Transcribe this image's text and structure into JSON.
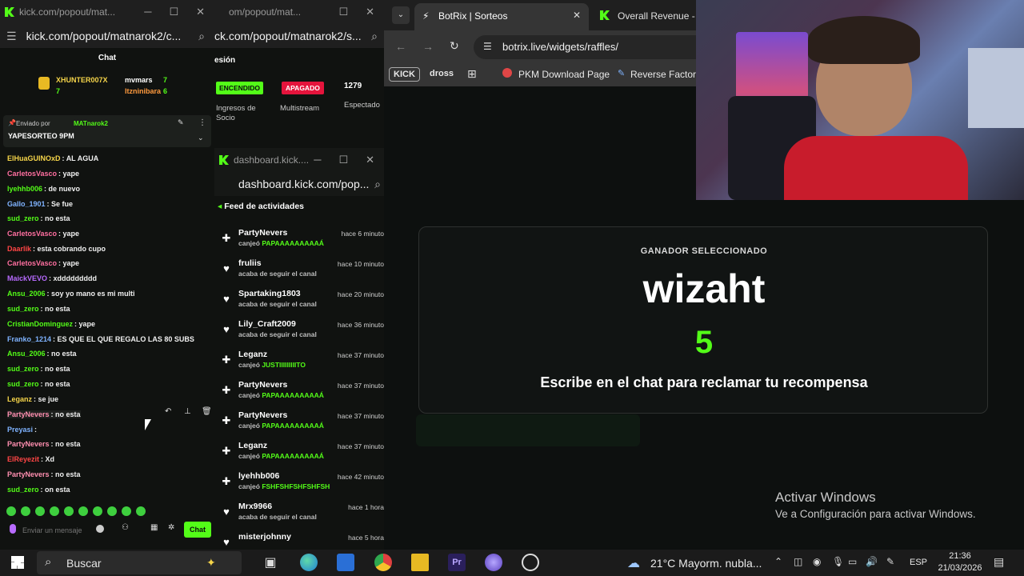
{
  "chat_window": {
    "title": "kick.com/popout/mat...",
    "url": "kick.com/popout/matnarok2/c...",
    "header": "Chat",
    "top_gifters": [
      {
        "name": "XHUNTER007X",
        "count": "7"
      },
      {
        "name": "mvmars",
        "count": "7"
      },
      {
        "name": "ltzninibara",
        "count": "6"
      }
    ],
    "pinned": {
      "sent_by_label": "Enviado por",
      "sent_by": "MATnarok2",
      "message": "YAPESORTEO 9PM"
    },
    "messages": [
      {
        "user": "ElHuaGUINOxD",
        "text": "AL AGUA",
        "color": "#f6d54a"
      },
      {
        "user": "CarletosVasco",
        "text": "yape",
        "color": "#ff6fa0"
      },
      {
        "user": "lyehhb006",
        "text": "de nuevo",
        "color": "#53fc18"
      },
      {
        "user": "Gallo_1901",
        "text": "Se fue",
        "color": "#7fb3ff"
      },
      {
        "user": "sud_zero",
        "text": "no esta",
        "color": "#53fc18"
      },
      {
        "user": "CarletosVasco",
        "text": "yape",
        "color": "#ff6fa0"
      },
      {
        "user": "Daarlik",
        "text": "esta cobrando cupo",
        "color": "#ff4545"
      },
      {
        "user": "CarletosVasco",
        "text": "yape",
        "color": "#ff6fa0"
      },
      {
        "user": "MaickVEVO",
        "text": "xddddddddd",
        "color": "#b86bff"
      },
      {
        "user": "Ansu_2006",
        "text": "soy yo mano es mi multi",
        "color": "#53fc18"
      },
      {
        "user": "sud_zero",
        "text": "no esta",
        "color": "#53fc18"
      },
      {
        "user": "CristianDominguez",
        "text": "yape",
        "color": "#53fc18"
      },
      {
        "user": "Franko_1214",
        "text": "ES QUE EL QUE REGALO LAS 80 SUBS",
        "color": "#7fb3ff"
      },
      {
        "user": "Ansu_2006",
        "text": "no esta",
        "color": "#53fc18"
      },
      {
        "user": "sud_zero",
        "text": "no esta",
        "color": "#53fc18"
      },
      {
        "user": "sud_zero",
        "text": "no esta",
        "color": "#53fc18"
      },
      {
        "user": "Leganz",
        "text": "se jue",
        "color": "#f6d54a"
      },
      {
        "user": "PartyNevers",
        "text": "no esta",
        "color": "#ff8fb0"
      },
      {
        "user": "Preyasi",
        "text": "",
        "color": "#7fb3ff"
      },
      {
        "user": "PartyNevers",
        "text": "no esta",
        "color": "#ff8fb0"
      },
      {
        "user": "ElReyezit",
        "text": "Xd",
        "color": "#ff4545"
      },
      {
        "user": "PartyNevers",
        "text": "no esta",
        "color": "#ff8fb0"
      },
      {
        "user": "sud_zero",
        "text": "on esta",
        "color": "#53fc18"
      }
    ],
    "input_placeholder": "Enviar un mensaje",
    "send_button": "Chat"
  },
  "dashboard_window": {
    "title": "om/popout/mat...",
    "url": "ck.com/popout/matnarok2/s...",
    "section": "esión",
    "toggle_on": "ENCENDIDO",
    "toggle_off": "APAGADO",
    "viewer_count": "1279",
    "col1": "Ingresos de Socio",
    "col2": "Multistream",
    "col3": "Espectado"
  },
  "feed_window": {
    "title": "dashboard.kick....",
    "url": "dashboard.kick.com/pop...",
    "feed_title": "Feed de actividades",
    "items": [
      {
        "icon": "redeem",
        "name": "PartyNevers",
        "action": "canjeó",
        "reward": "PAPAAAAAAAAAÁ",
        "time": "hace 6 minuto"
      },
      {
        "icon": "heart",
        "name": "fruliis",
        "action": "acaba de seguir el canal",
        "reward": "",
        "time": "hace 10 minuto"
      },
      {
        "icon": "heart",
        "name": "Spartaking1803",
        "action": "acaba de seguir el canal",
        "reward": "",
        "time": "hace 20 minuto"
      },
      {
        "icon": "heart",
        "name": "Lily_Craft2009",
        "action": "acaba de seguir el canal",
        "reward": "",
        "time": "hace 36 minuto"
      },
      {
        "icon": "redeem",
        "name": "Leganz",
        "action": "canjeó",
        "reward": "JUSTIIIIIIIIITO",
        "time": "hace 37 minuto"
      },
      {
        "icon": "redeem",
        "name": "PartyNevers",
        "action": "canjeó",
        "reward": "PAPAAAAAAAAAÁ",
        "time": "hace 37 minuto"
      },
      {
        "icon": "redeem",
        "name": "PartyNevers",
        "action": "canjeó",
        "reward": "PAPAAAAAAAAAÁ",
        "time": "hace 37 minuto"
      },
      {
        "icon": "redeem",
        "name": "Leganz",
        "action": "canjeó",
        "reward": "PAPAAAAAAAAAÁ",
        "time": "hace 37 minuto"
      },
      {
        "icon": "redeem",
        "name": "lyehhb006",
        "action": "canjeó",
        "reward": "FSHFSHFSHFSHFSH",
        "time": "hace 42 minuto"
      },
      {
        "icon": "heart",
        "name": "Mrx9966",
        "action": "acaba de seguir el canal",
        "reward": "",
        "time": "hace 1 hora"
      },
      {
        "icon": "heart",
        "name": "misterjohnny",
        "action": "",
        "reward": "",
        "time": "hace 5 hora"
      }
    ]
  },
  "browser": {
    "tabs": [
      {
        "label": "BotRix | Sorteos",
        "active": true
      },
      {
        "label": "Overall Revenue - K",
        "active": false
      }
    ],
    "url": "botrix.live/widgets/raffles/",
    "bookmarks": [
      "KICK",
      "dross",
      "PKM Download Page",
      "Reverse Factorin"
    ]
  },
  "raffle": {
    "label": "GANADOR SELECCIONADO",
    "winner": "wizaht",
    "countdown": "5",
    "instruction": "Escribe en el chat para reclamar tu recompensa"
  },
  "watermark": {
    "line1": "Activar Windows",
    "line2": "Ve a Configuración para activar Windows."
  },
  "taskbar": {
    "search": "Buscar",
    "weather": "21°C  Mayorm. nubla...",
    "language": "ESP",
    "time": "21:36",
    "date": "21/03/2026"
  },
  "colors": {
    "kick_green": "#53fc18",
    "background": "#0b0e0d",
    "off_red": "#e5143c"
  }
}
